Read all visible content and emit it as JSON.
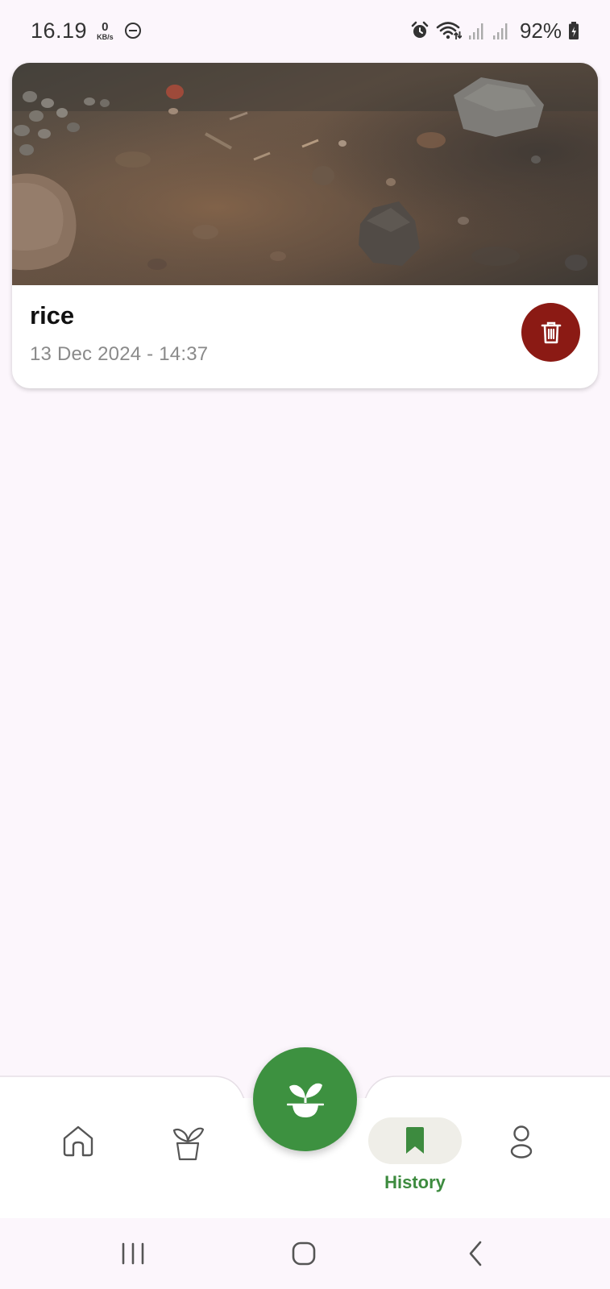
{
  "status_bar": {
    "time": "16.19",
    "net_speed_value": "0",
    "net_speed_unit": "KB/s",
    "battery_percent": "92%",
    "icons": [
      "do-not-disturb-icon",
      "alarm-icon",
      "wifi-icon",
      "signal-icon",
      "signal-icon",
      "battery-charging-icon"
    ]
  },
  "history": {
    "items": [
      {
        "title": "rice",
        "date": "13 Dec 2024 - 14:37",
        "image": "soil-photo",
        "action_icon": "trash-icon"
      }
    ]
  },
  "bottom_nav": {
    "items": [
      {
        "id": "home",
        "icon": "home-icon",
        "label": "",
        "active": false
      },
      {
        "id": "plants",
        "icon": "plant-pot-icon",
        "label": "",
        "active": false
      },
      {
        "id": "history",
        "icon": "bookmark-icon",
        "label": "History",
        "active": true
      },
      {
        "id": "profile",
        "icon": "person-icon",
        "label": "",
        "active": false
      }
    ],
    "fab_icon": "sprout-icon"
  },
  "system_nav": {
    "buttons": [
      "recents-icon",
      "home-circle-icon",
      "back-icon"
    ]
  },
  "colors": {
    "background": "#FCF6FC",
    "accent_green": "#3D9140",
    "active_label": "#3D8B3F",
    "delete_red": "#8B1A14",
    "pill_bg": "#EFEEE8"
  }
}
